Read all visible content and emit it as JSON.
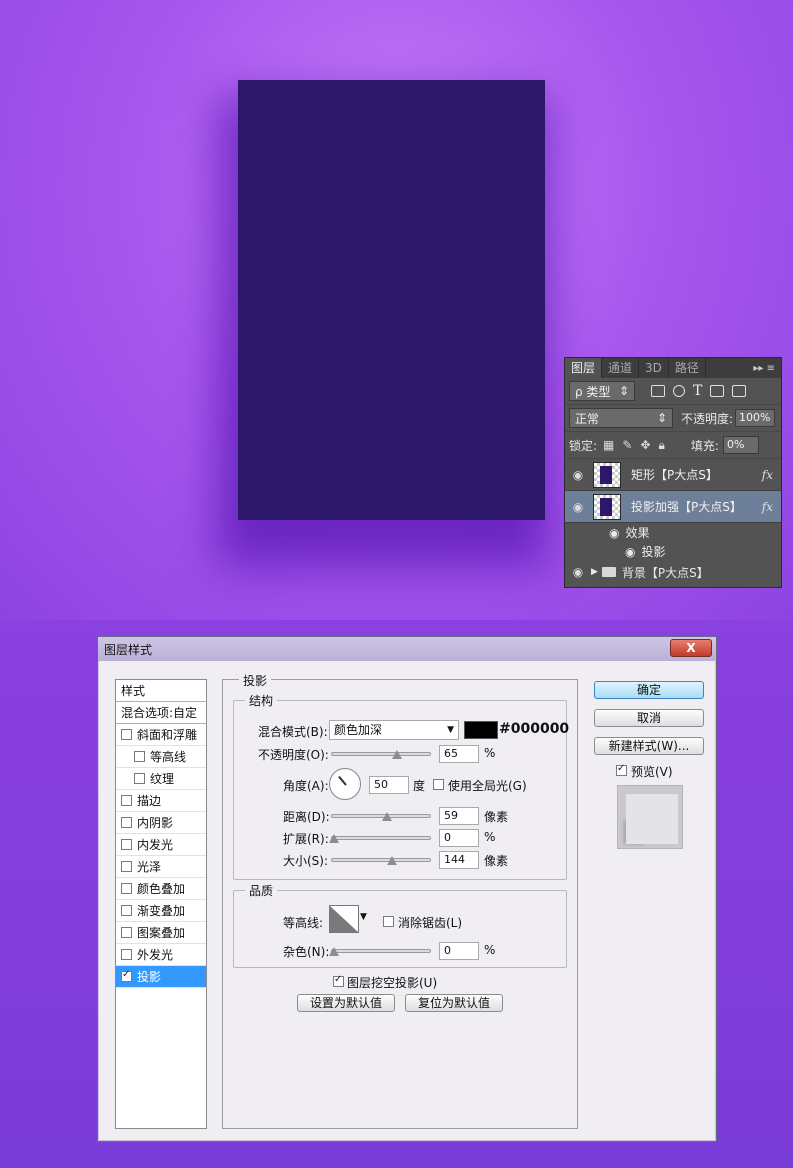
{
  "layers_panel": {
    "tabs": [
      "图层",
      "通道",
      "3D",
      "路径"
    ],
    "filter": {
      "kind": "ρ 类型"
    },
    "blend_mode": "正常",
    "opacity_label": "不透明度:",
    "opacity_value": "100%",
    "lock_label": "锁定:",
    "fill_label": "填充:",
    "fill_value": "0%",
    "layers": [
      {
        "name": "矩形【P大点S】",
        "fx": "fx"
      },
      {
        "name": "投影加强【P大点S】",
        "fx": "fx"
      }
    ],
    "effects_label": "效果",
    "effect_drop_shadow": "投影",
    "background_group": "背景【P大点S】"
  },
  "dialog": {
    "title": "图层样式",
    "close_label": "X",
    "styles_header": "样式",
    "blend_options": "混合选项:自定",
    "style_items": [
      {
        "label": "斜面和浮雕",
        "checked": false,
        "indent": false
      },
      {
        "label": "等高线",
        "checked": false,
        "indent": true
      },
      {
        "label": "纹理",
        "checked": false,
        "indent": true
      },
      {
        "label": "描边",
        "checked": false,
        "indent": false
      },
      {
        "label": "内阴影",
        "checked": false,
        "indent": false
      },
      {
        "label": "内发光",
        "checked": false,
        "indent": false
      },
      {
        "label": "光泽",
        "checked": false,
        "indent": false
      },
      {
        "label": "颜色叠加",
        "checked": false,
        "indent": false
      },
      {
        "label": "渐变叠加",
        "checked": false,
        "indent": false
      },
      {
        "label": "图案叠加",
        "checked": false,
        "indent": false
      },
      {
        "label": "外发光",
        "checked": false,
        "indent": false
      },
      {
        "label": "投影",
        "checked": true,
        "indent": false
      }
    ],
    "section_title": "投影",
    "structure": {
      "title": "结构",
      "blend_mode_label": "混合模式(B):",
      "blend_mode_value": "颜色加深",
      "color_hex": "#000000",
      "opacity_label": "不透明度(O):",
      "opacity_value": "65",
      "opacity_unit": "%",
      "opacity_level": 0.65,
      "angle_label": "角度(A):",
      "angle_value": "50",
      "angle_unit": "度",
      "global_light_label": "使用全局光(G)",
      "distance_label": "距离(D):",
      "distance_value": "59",
      "distance_unit": "像素",
      "spread_label": "扩展(R):",
      "spread_value": "0",
      "spread_unit": "%",
      "size_label": "大小(S):",
      "size_value": "144",
      "size_unit": "像素"
    },
    "quality": {
      "title": "品质",
      "contour_label": "等高线:",
      "antialias_label": "消除锯齿(L)",
      "noise_label": "杂色(N):",
      "noise_value": "0",
      "noise_unit": "%"
    },
    "knockout_label": "图层挖空投影(U)",
    "set_default_label": "设置为默认值",
    "reset_default_label": "复位为默认值",
    "buttons": {
      "ok": "确定",
      "cancel": "取消",
      "new_style": "新建样式(W)...",
      "preview": "预览(V)"
    }
  }
}
